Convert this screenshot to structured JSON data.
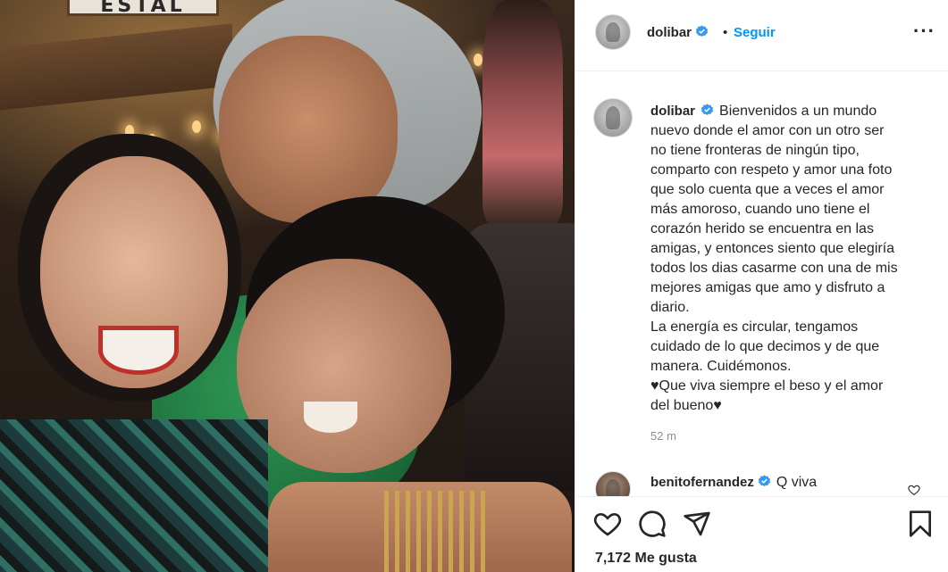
{
  "post": {
    "photo_alt": "",
    "sign_text": "ESTAL"
  },
  "header": {
    "username": "dolibar",
    "separator": "•",
    "follow_label": "Seguir",
    "more_label": "···"
  },
  "caption": {
    "username": "dolibar",
    "text": "Bienvenidos a un mundo\nnuevo donde el amor con un otro ser\nno tiene fronteras de ningún tipo,\ncomparto con respeto y amor una foto\nque solo cuenta que a veces el amor\nmás amoroso, cuando uno tiene el\ncorazón herido se encuentra en las\namigas, y entonces siento que elegiría\ntodos los dias casarme con una de mis\nmejores amigas que amo y disfruto a\ndiario.\nLa energía es circular, tengamos\ncuidado de lo que decimos y de que\nmanera. Cuidémonos.\n♥Que viva siempre el beso y el amor\ndel bueno♥",
    "time": "52 m"
  },
  "comments": [
    {
      "username": "benitofernandez",
      "text": "Q viva"
    }
  ],
  "footer": {
    "likes": "7,172 Me gusta"
  },
  "colors": {
    "accent": "#0095f6",
    "verified": "#3897f0",
    "text": "#262626",
    "muted": "#8e8e8e",
    "border": "#efefef"
  },
  "icons": {
    "like": "heart-icon",
    "comment": "comment-icon",
    "share": "paper-plane-icon",
    "save": "bookmark-icon",
    "more": "more-options-icon",
    "verified": "verified-badge-icon"
  }
}
